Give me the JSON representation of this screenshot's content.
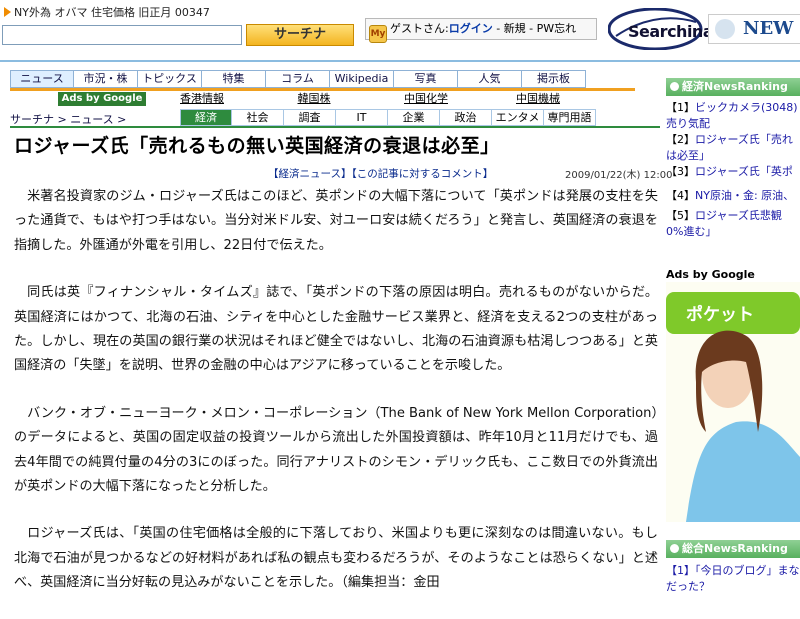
{
  "ticker": {
    "text": "NY外為 オバマ 住宅価格 旧正月 00347"
  },
  "search": {
    "button": "サーチナ",
    "value": ""
  },
  "account": {
    "guest": "ゲストさん:",
    "login": "ログイン",
    "new": "新規",
    "pw": "PW忘れ",
    "sep1": " - ",
    "sep2": " - ",
    "icon_text": "My"
  },
  "brand": {
    "logo": "Searchina",
    "banner": "NEW"
  },
  "nav": {
    "items": [
      "ニュース",
      "市況・株",
      "トピックス",
      "特集",
      "コラム",
      "Wikipedia",
      "写真",
      "人気",
      "掲示板"
    ],
    "active": 0
  },
  "subnav": {
    "ads_label": "Ads by Google",
    "items": [
      "香港情報",
      "韓国株",
      "中国化学",
      "中国機械"
    ]
  },
  "breadcrumb": {
    "text": "サーチナ > ニュース >"
  },
  "categories": {
    "items": [
      "経済",
      "社会",
      "調査",
      "IT",
      "企業",
      "政治",
      "エンタメ",
      "専門用語"
    ],
    "active": 0
  },
  "article": {
    "title": "ロジャーズ氏「売れるもの無い英国経済の衰退は必至」",
    "category_link": "【経済ニュース】",
    "comment_link": "【この記事に対するコメント】",
    "date": "2009/01/22(木) 12:00",
    "paragraphs": [
      "米著名投資家のジム・ロジャーズ氏はこのほど、英ポンドの大幅下落について「英ポンドは発展の支柱を失った通貨で、もはや打つ手はない。当分対米ドル安、対ユーロ安は続くだろう」と発言し、英国経済の衰退を指摘した。外匯通が外電を引用し、22日付で伝えた。",
      "同氏は英『フィナンシャル・タイムズ』誌で、「英ポンドの下落の原因は明白。売れるものがないからだ。英国経済にはかつて、北海の石油、シティを中心とした金融サービス業界と、経済を支える2つの支柱があった。しかし、現在の英国の銀行業の状況はそれほど健全ではないし、北海の石油資源も枯渇しつつある」と英国経済の「失墜」を説明、世界の金融の中心はアジアに移っていることを示唆した。",
      "バンク・オブ・ニューヨーク・メロン・コーポレーション（The Bank of New York Mellon Corporation）のデータによると、英国の固定収益の投資ツールから流出した外国投資額は、昨年10月と11月だけでも、過去4年間での純買付量の4分の3にのぼった。同行アナリストのシモン・デリック氏も、ここ数日での外貨流出が英ポンドの大幅下落になったと分析した。",
      "ロジャーズ氏は、「英国の住宅価格は全般的に下落しており、米国よりも更に深刻なのは間違いない。もし北海で石油が見つかるなどの好材料があれば私の観点も変わるだろうが、そのようなことは恐らくない」と述べ、英国経済に当分好転の見込みがないことを示した。（編集担当：金田"
    ]
  },
  "sidebar": {
    "ranking_header": "経済NewsRanking",
    "ranking": [
      {
        "num": "【1】",
        "text": "ビックカメラ(3048)"
      },
      {
        "num": "",
        "text": "売り気配"
      },
      {
        "num": "【2】",
        "text": "ロジャーズ氏「売れ"
      },
      {
        "num": "",
        "text": "は必至」"
      },
      {
        "num": "【3】",
        "text": "ロジャーズ氏「英ポ"
      },
      {
        "num": "【4】",
        "text": "NY原油・金: 原油、"
      },
      {
        "num": "【5】",
        "text": "ロジャーズ氏悲観"
      },
      {
        "num": "",
        "text": "0%進む」"
      }
    ],
    "ads_label": "Ads by Google",
    "ad_text": "ポケット",
    "total_header": "総合NewsRanking",
    "total_item": "【1】「今日のブログ」まな",
    "total_item2": "だった？"
  },
  "colors": {
    "accent_green": "#2e8b3e",
    "nav_orange": "#f0a020",
    "link_blue": "#1a1aa6"
  }
}
